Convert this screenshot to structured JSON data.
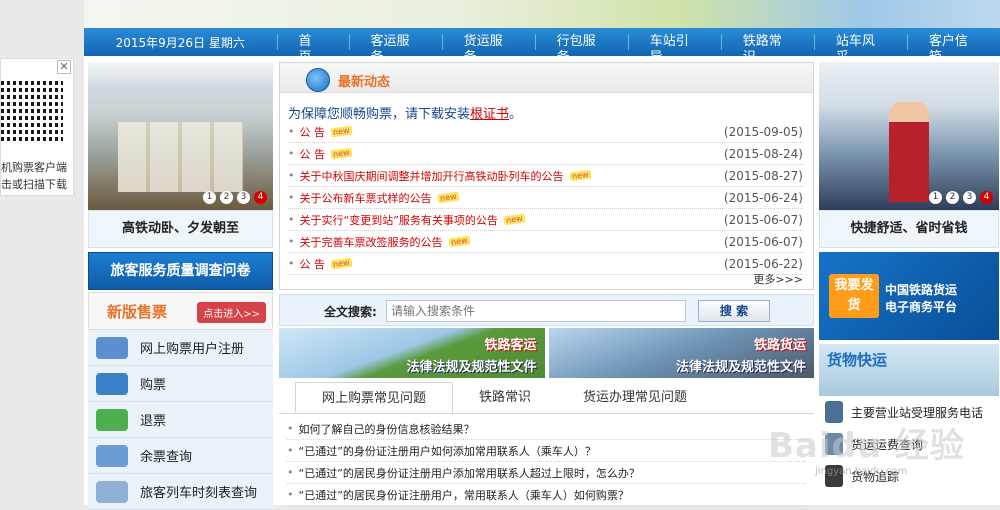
{
  "qr": {
    "close": "✕",
    "lines": [
      "机购票客户端",
      "击或扫描下载"
    ]
  },
  "nav": {
    "date": "2015年9月26日 星期六",
    "items": [
      "首 页",
      "客运服务",
      "货运服务",
      "行包服务",
      "车站引导",
      "铁路常识",
      "站车风采",
      "客户信箱"
    ]
  },
  "left": {
    "pager": [
      "1",
      "2",
      "3",
      "4"
    ],
    "caption": "高铁动卧、夕发朝至",
    "survey": "旅客服务质量调查问卷",
    "new_ticket": "新版售票",
    "new_ticket_button": "点击进入>>",
    "menu": [
      "网上购票用户注册",
      "购票",
      "退票",
      "余票查询",
      "旅客列车时刻表查询"
    ]
  },
  "news": {
    "title": "最新动态",
    "notice_prefix": "为保障您顺畅购票，请下载安装",
    "notice_link": "根证书",
    "notice_suffix": "。",
    "new_badge": "new",
    "items": [
      {
        "title": "公 告",
        "date": "(2015-09-05)"
      },
      {
        "title": "公 告",
        "date": "(2015-08-24)"
      },
      {
        "title": "关于中秋国庆期间调整并增加开行高铁动卧列车的公告",
        "date": "(2015-08-27)"
      },
      {
        "title": "关于公布新车票式样的公告",
        "date": "(2015-06-24)"
      },
      {
        "title": "关于实行“变更到站”服务有关事项的公告",
        "date": "(2015-06-07)"
      },
      {
        "title": "关于完善车票改签服务的公告",
        "date": "(2015-06-07)"
      },
      {
        "title": "公 告",
        "date": "(2015-06-22)"
      }
    ],
    "more": "更多>>>"
  },
  "search": {
    "label": "全文搜索:",
    "placeholder": "请输入搜索条件",
    "button": "搜 索"
  },
  "banners": [
    {
      "t1": "铁路客运",
      "t2": "法律法规及规范性文件"
    },
    {
      "t1": "铁路货运",
      "t2": "法律法规及规范性文件"
    }
  ],
  "tabs": [
    "网上购票常见问题",
    "铁路常识",
    "货运办理常见问题"
  ],
  "faq": [
    "如何了解自己的身份信息核验结果？",
    "“已通过”的身份证注册用户如何添加常用联系人（乘车人）？",
    "“已通过”的居民身份证注册用户添加常用联系人超过上限时，怎么办？",
    "“已通过”的居民身份证注册用户，常用联系人（乘车人）如何购票？"
  ],
  "right": {
    "pager": [
      "1",
      "2",
      "3",
      "4"
    ],
    "caption": "快捷舒适、省时省钱",
    "cargo_tag": "我要发货",
    "cargo_lines": [
      "中国铁路货运",
      "电子商务平台"
    ],
    "express": "货物快运",
    "links": [
      "主要营业站受理服务电话",
      "货运运费查询",
      "货物追踪"
    ]
  },
  "watermark": "Baidu 经验",
  "watermark_url": "jingyan.baidu.com"
}
